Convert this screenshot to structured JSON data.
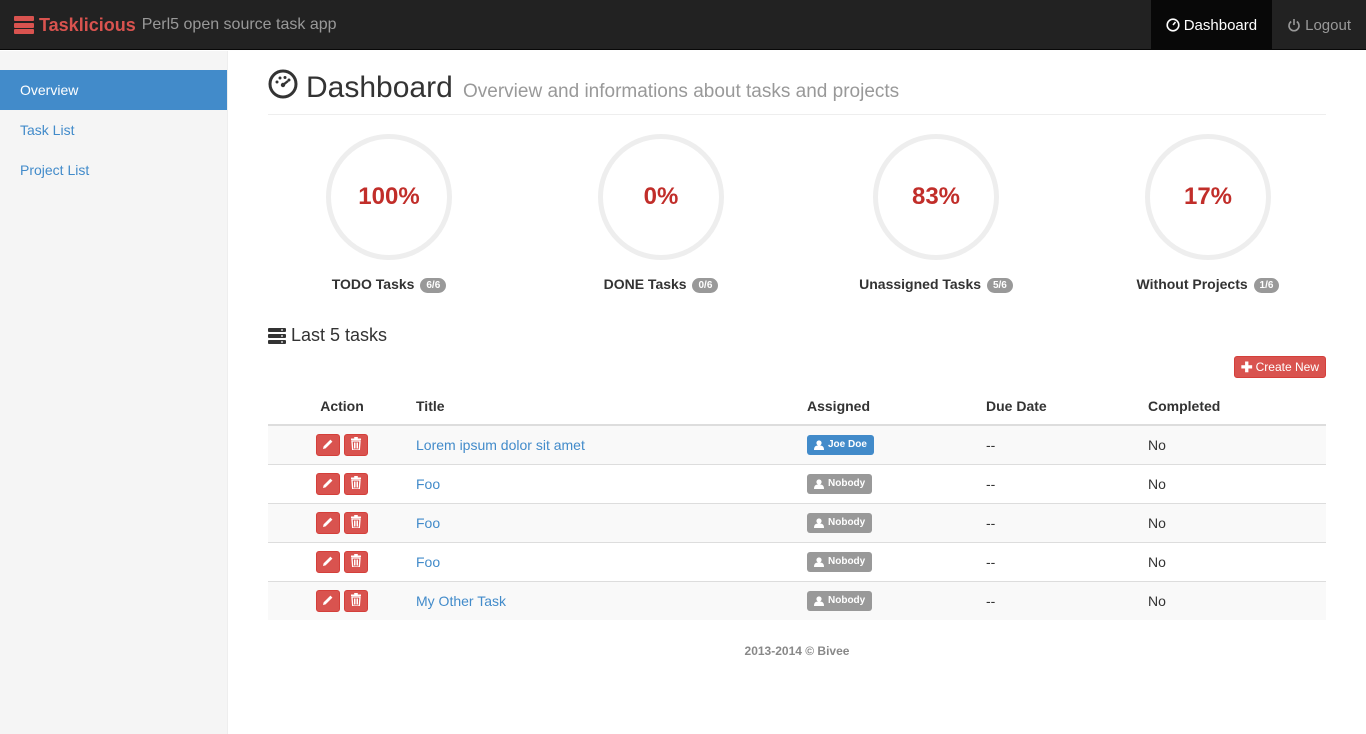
{
  "navbar": {
    "brand": "Tasklicious",
    "tagline": "Perl5 open source task app",
    "links": [
      {
        "label": "Dashboard",
        "icon": "dashboard-icon",
        "active": true
      },
      {
        "label": "Logout",
        "icon": "power-icon",
        "active": false
      }
    ]
  },
  "sidebar": {
    "items": [
      {
        "label": "Overview",
        "active": true
      },
      {
        "label": "Task List",
        "active": false
      },
      {
        "label": "Project List",
        "active": false
      }
    ]
  },
  "header": {
    "title": "Dashboard",
    "subtitle": "Overview and informations about tasks and projects"
  },
  "stats": [
    {
      "value": "100%",
      "label": "TODO Tasks",
      "badge": "6/6"
    },
    {
      "value": "0%",
      "label": "DONE Tasks",
      "badge": "0/6"
    },
    {
      "value": "83%",
      "label": "Unassigned Tasks",
      "badge": "5/6"
    },
    {
      "value": "17%",
      "label": "Without Projects",
      "badge": "1/6"
    }
  ],
  "last_tasks": {
    "title": "Last 5 tasks",
    "create_label": "Create New",
    "columns": [
      "Action",
      "Title",
      "Assigned",
      "Due Date",
      "Completed"
    ],
    "rows": [
      {
        "title": "Lorem ipsum dolor sit amet",
        "assigned": "Joe Doe",
        "assigned_color": "#428bca",
        "due": "--",
        "completed": "No"
      },
      {
        "title": "Foo",
        "assigned": "Nobody",
        "assigned_color": "#999999",
        "due": "--",
        "completed": "No"
      },
      {
        "title": "Foo",
        "assigned": "Nobody",
        "assigned_color": "#999999",
        "due": "--",
        "completed": "No"
      },
      {
        "title": "Foo",
        "assigned": "Nobody",
        "assigned_color": "#999999",
        "due": "--",
        "completed": "No"
      },
      {
        "title": "My Other Task",
        "assigned": "Nobody",
        "assigned_color": "#999999",
        "due": "--",
        "completed": "No"
      }
    ]
  },
  "footer": {
    "text": "2013-2014 © Bivee"
  },
  "colors": {
    "accent": "#428bca",
    "danger": "#d9534f",
    "navbar": "#222222"
  }
}
